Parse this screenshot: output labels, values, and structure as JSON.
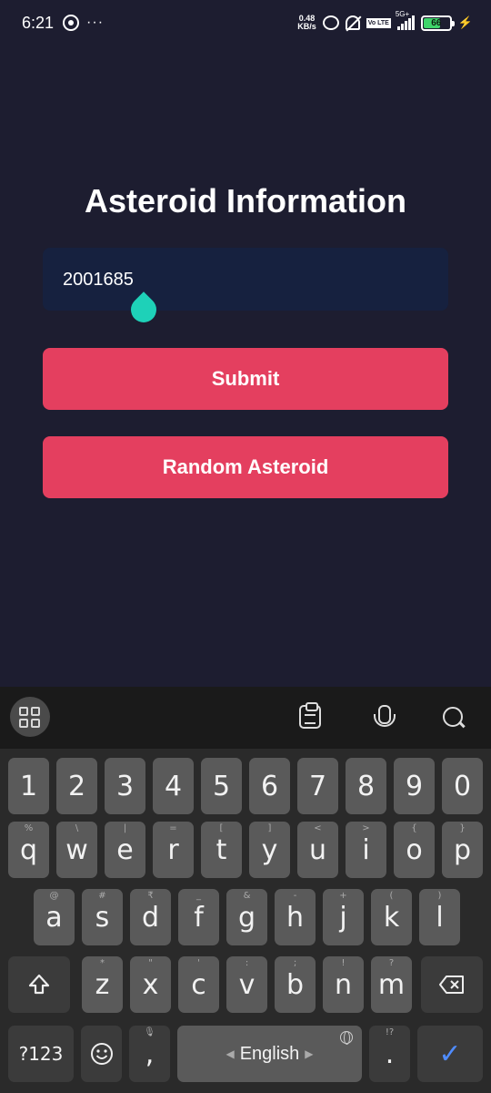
{
  "status_bar": {
    "time": "6:21",
    "more": "···",
    "net_speed": "0.48",
    "net_unit": "KB/s",
    "volte": "Vo LTE",
    "network": "5G+",
    "battery": "66"
  },
  "app": {
    "title": "Asteroid Information",
    "input_value": "2001685",
    "submit_label": "Submit",
    "random_label": "Random Asteroid"
  },
  "keyboard": {
    "numbers": [
      "1",
      "2",
      "3",
      "4",
      "5",
      "6",
      "7",
      "8",
      "9",
      "0"
    ],
    "row1": [
      "q",
      "w",
      "e",
      "r",
      "t",
      "y",
      "u",
      "i",
      "o",
      "p"
    ],
    "row1_sub": [
      "%",
      "\\",
      "|",
      "=",
      "[",
      "]",
      "<",
      ">",
      "{",
      "}"
    ],
    "row2": [
      "a",
      "s",
      "d",
      "f",
      "g",
      "h",
      "j",
      "k",
      "l"
    ],
    "row2_sub": [
      "@",
      "#",
      "₹",
      "_",
      "&",
      "-",
      "+",
      "(",
      ")"
    ],
    "row3": [
      "z",
      "x",
      "c",
      "v",
      "b",
      "n",
      "m"
    ],
    "row3_sub": [
      "*",
      "\"",
      "'",
      ":",
      ";",
      "!",
      "?"
    ],
    "symbols_label": "?123",
    "comma": ",",
    "period": ".",
    "period_sub": "!?",
    "space_label": "English",
    "colors": {
      "accent": "#e43f5f",
      "enter": "#4f8cff"
    }
  }
}
